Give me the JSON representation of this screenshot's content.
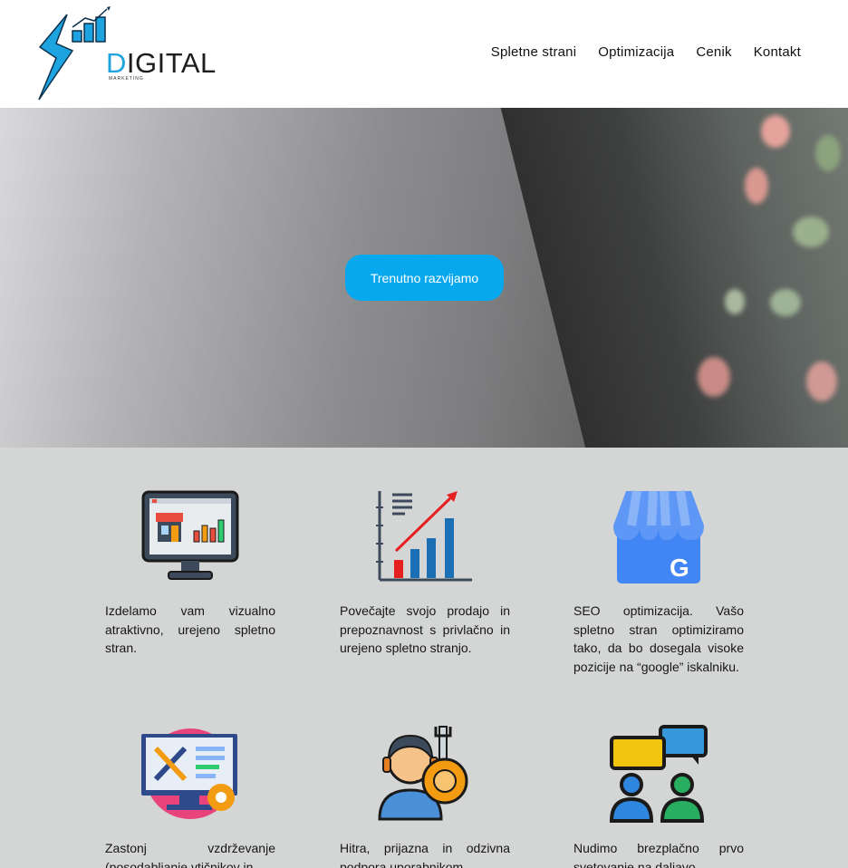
{
  "header": {
    "logo": {
      "text_d": "D",
      "text_rest": "IGITAL",
      "sub": "MARKETING"
    },
    "nav": [
      "Spletne strani",
      "Optimizacija",
      "Cenik",
      "Kontakt"
    ]
  },
  "hero": {
    "cta_label": "Trenutno razvijamo"
  },
  "features": [
    {
      "icon": "monitor-shop-icon",
      "text": "Izdelamo vam vizualno atraktivno, urejeno spletno stran."
    },
    {
      "icon": "growth-chart-icon",
      "text": "Povečajte svojo prodajo in prepoznavnost s privlačno in urejeno spletno stranjo."
    },
    {
      "icon": "google-business-icon",
      "text": "SEO optimizacija. Vašo spletno stran optimiziramo tako, da bo dosegala visoke pozicije na “google” iskalniku."
    },
    {
      "icon": "maintenance-screen-icon",
      "text": "Zastonj vzdrževanje (posodabljanje vtičnikov in"
    },
    {
      "icon": "support-agent-icon",
      "text": "Hitra, prijazna in odzivna podpora uporabnikom."
    },
    {
      "icon": "consultation-icon",
      "text": "Nudimo brezplačno prvo svetovanje na daljavo."
    }
  ],
  "colors": {
    "accent": "#08a8ef",
    "background": "#d4d5d5"
  }
}
